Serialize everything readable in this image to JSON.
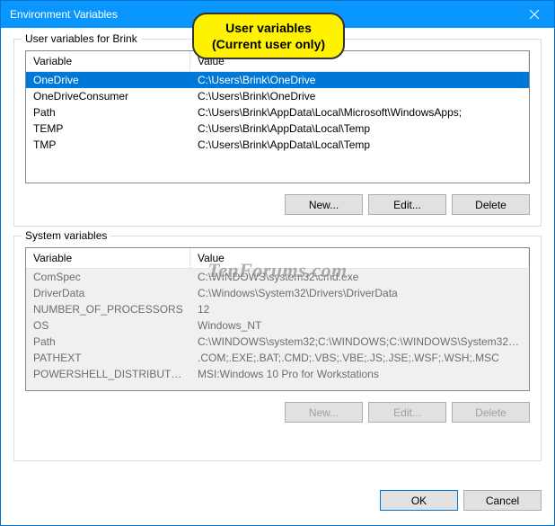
{
  "titlebar": {
    "title": "Environment Variables"
  },
  "annotation": {
    "line1": "User variables",
    "line2": "(Current user only)"
  },
  "watermark": "TenForums.com",
  "userGroup": {
    "legend": "User variables for Brink",
    "columns": {
      "variable": "Variable",
      "value": "Value"
    },
    "rows": [
      {
        "name": "OneDrive",
        "value": "C:\\Users\\Brink\\OneDrive",
        "selected": true
      },
      {
        "name": "OneDriveConsumer",
        "value": "C:\\Users\\Brink\\OneDrive"
      },
      {
        "name": "Path",
        "value": "C:\\Users\\Brink\\AppData\\Local\\Microsoft\\WindowsApps;"
      },
      {
        "name": "TEMP",
        "value": "C:\\Users\\Brink\\AppData\\Local\\Temp"
      },
      {
        "name": "TMP",
        "value": "C:\\Users\\Brink\\AppData\\Local\\Temp"
      }
    ],
    "buttons": {
      "new": "New...",
      "edit": "Edit...",
      "delete": "Delete"
    }
  },
  "systemGroup": {
    "legend": "System variables",
    "columns": {
      "variable": "Variable",
      "value": "Value"
    },
    "rows": [
      {
        "name": "ComSpec",
        "value": "C:\\WINDOWS\\system32\\cmd.exe"
      },
      {
        "name": "DriverData",
        "value": "C:\\Windows\\System32\\Drivers\\DriverData"
      },
      {
        "name": "NUMBER_OF_PROCESSORS",
        "value": "12"
      },
      {
        "name": "OS",
        "value": "Windows_NT"
      },
      {
        "name": "Path",
        "value": "C:\\WINDOWS\\system32;C:\\WINDOWS;C:\\WINDOWS\\System32\\Wb..."
      },
      {
        "name": "PATHEXT",
        "value": ".COM;.EXE;.BAT;.CMD;.VBS;.VBE;.JS;.JSE;.WSF;.WSH;.MSC"
      },
      {
        "name": "POWERSHELL_DISTRIBUTIO...",
        "value": "MSI:Windows 10 Pro for Workstations"
      }
    ],
    "buttons": {
      "new": "New...",
      "edit": "Edit...",
      "delete": "Delete"
    },
    "buttonsDisabled": true
  },
  "footer": {
    "ok": "OK",
    "cancel": "Cancel"
  }
}
